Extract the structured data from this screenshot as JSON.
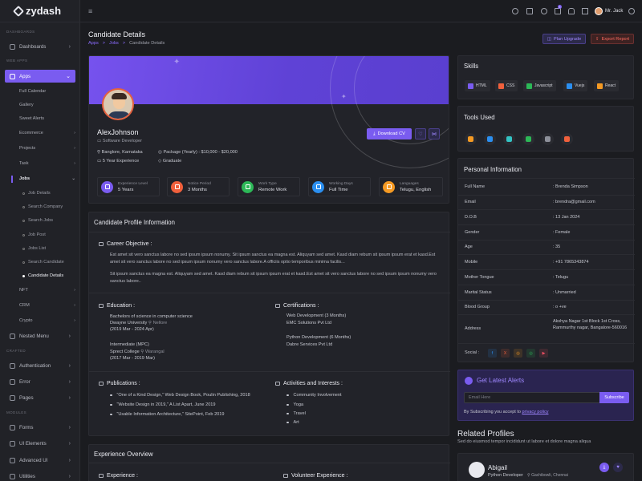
{
  "brand": {
    "name": "zydash"
  },
  "sidebar": {
    "sections": {
      "dashboards": "DASHBOARDS",
      "web_apps": "WEB APPS",
      "crafted": "CRAFTED",
      "modules": "MODULES"
    },
    "dashboards": "Dashboards",
    "apps": "Apps",
    "app_items": [
      "Full Calendar",
      "Gallery",
      "Sweet Alerts",
      "Ecommerce",
      "Projects",
      "Task",
      "Jobs"
    ],
    "jobs_items": [
      "Job Details",
      "Search Company",
      "Search Jobs",
      "Job Post",
      "Jobs List",
      "Search Candidate",
      "Candidate Details"
    ],
    "more_items": [
      "NFT",
      "CRM",
      "Crypto"
    ],
    "nested": "Nested Menu",
    "crafted_items": [
      "Authentication",
      "Error",
      "Pages"
    ],
    "module_items": [
      "Forms",
      "UI Elements",
      "Advanced UI",
      "Utilities"
    ]
  },
  "topbar": {
    "user": "Mr. Jack",
    "cart_count": "5"
  },
  "header": {
    "title": "Candidate Details",
    "crumbs": [
      "Apps",
      "Jobs",
      "Candidate Details"
    ],
    "sep": ">",
    "upgrade": "Plan Upgrade",
    "export": "Export Report"
  },
  "profile": {
    "name": "AlexJohnson",
    "role": "Software Developer",
    "location": "Banglore, Karnataka",
    "package": "Package (Yearly) : $10,000 - $20,000",
    "experience": "5 Year Experience",
    "education": "Graduate",
    "download": "Download CV",
    "stats": [
      {
        "label": "Experience Level",
        "value": "5 Years",
        "color": "#7a5cf0"
      },
      {
        "label": "Notice Period",
        "value": "3 Months",
        "color": "#f0603c"
      },
      {
        "label": "Work Type",
        "value": "Remote Work",
        "color": "#2cb857"
      },
      {
        "label": "Working Days",
        "value": "Full Time",
        "color": "#2b8ff0"
      },
      {
        "label": "Languages",
        "value": "Telugu, English",
        "color": "#f59a23"
      }
    ]
  },
  "candidate": {
    "title": "Candidate Profile Information",
    "objective_title": "Career Objective :",
    "objective_p1": "Est amet sit vero sanctus labore no sed ipsum ipsum nonumy. Sit ipsum sanctus ea magna est. Aliquyam sed amet. Kasd diam rebum sit ipsum ipsum erat et kasd.Est amet sit vero sanctus labore no sed ipsum ipsum nonumy vero sanctus labore.A officiis optio temporibus minima facilis...",
    "objective_p2": "Sit ipsum sanctus ea magna est. Aliquyam sed amet. Kasd diam rebum sit ipsum ipsum erat et kasd.Est amet sit vero sanctus labore no sed ipsum ipsum nonumy vero sanctus labore..",
    "education_title": "Education :",
    "education": [
      {
        "degree": "Bachelors of science in computer science",
        "school": "Dwayne University",
        "place": "Nellore",
        "years": "(2019 Mar - 2024 Apr)"
      },
      {
        "degree": "Intermediate (MPC)",
        "school": "Sprect College",
        "place": "Warangal",
        "years": "(2017 Mar - 2019 Mar)"
      }
    ],
    "cert_title": "Certifications :",
    "certs": [
      {
        "name": "Web Development (3 Months)",
        "org": "EMC Solutions Pvt Ltd"
      },
      {
        "name": "Python Development (6 Months)",
        "org": "Dabre Services Pvt Ltd"
      }
    ],
    "pub_title": "Publications :",
    "pubs": [
      "“One of a Kind Design,” Web Design Book, Poulin Publishing, 2018",
      "“Website Design in 2019,” A List Apart, June 2019",
      "“Usable Information Architecture,” SitePoint, Feb 2019"
    ],
    "act_title": "Activities and Interests :",
    "acts": [
      "Community Involvement",
      "Yoga",
      "Travel",
      "Art"
    ]
  },
  "experience": {
    "title": "Experience Overview",
    "exp_label": "Experience :",
    "vol_label": "Volunteer Experience :"
  },
  "skills": {
    "title": "Skills",
    "items": [
      {
        "name": "HTML",
        "color": "#7a5cf0"
      },
      {
        "name": "CSS",
        "color": "#f0603c"
      },
      {
        "name": "Javascript",
        "color": "#2cb857"
      },
      {
        "name": "Vuejs",
        "color": "#2b8ff0"
      },
      {
        "name": "React",
        "color": "#f59a23"
      }
    ]
  },
  "tools": {
    "title": "Tools Used",
    "colors": [
      "#f59a23",
      "#2b8ff0",
      "#33c4c4",
      "#2cb857",
      "#8d909a",
      "#f0603c"
    ]
  },
  "personal": {
    "title": "Personal Information",
    "rows": [
      {
        "k": "Full Name",
        "v": ": Brenda Simpson"
      },
      {
        "k": "Email",
        "v": ": brendra@gmail.com"
      },
      {
        "k": "D.O.B",
        "v": ": 13 Jan 2024"
      },
      {
        "k": "Gender",
        "v": ": Female"
      },
      {
        "k": "Age",
        "v": ": 35"
      },
      {
        "k": "Mobile",
        "v": ": +91 7865343874"
      },
      {
        "k": "Mother Tongue",
        "v": ": Telugu"
      },
      {
        "k": "Marital Status",
        "v": ": Unmarried"
      },
      {
        "k": "Blood Group",
        "v": ": o +ve"
      }
    ],
    "address_key": "Address",
    "address_val": "Akshya Nagar 1st Block 1st Cross, Rammurthy nagar, Bangalore-560016",
    "social_key": "Social :",
    "social": [
      {
        "g": "f",
        "c": "#2b8ff0"
      },
      {
        "g": "X",
        "c": "#f0603c"
      },
      {
        "g": "◎",
        "c": "#f59a23"
      },
      {
        "g": "◎",
        "c": "#2cb857"
      },
      {
        "g": "▶",
        "c": "#f04f63"
      }
    ]
  },
  "alerts": {
    "title": "Get Latest Alerts",
    "placeholder": "Email Here",
    "subscribe": "Subscribe",
    "note": "By Subscribing you accept to",
    "link": "privacy policy"
  },
  "related": {
    "title": "Related Profiles",
    "subtitle": "Sed do eiusmod tempor incididunt ut labore et dolore magna aliqua",
    "name": "Abigail",
    "role": "Python Developer",
    "location": "Gachibowli, Chennai"
  }
}
